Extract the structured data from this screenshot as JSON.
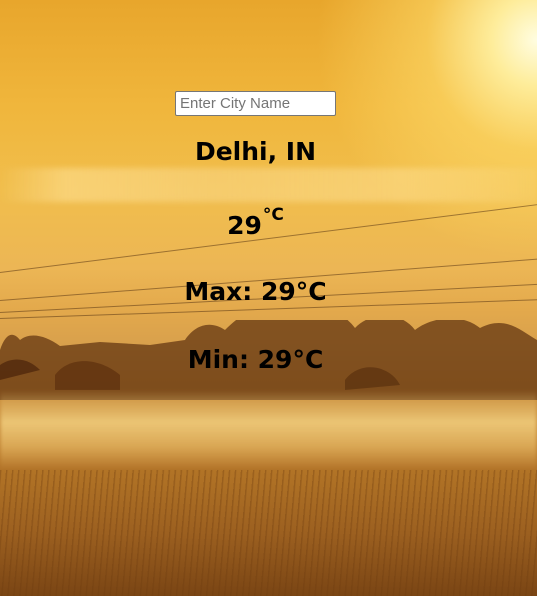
{
  "search": {
    "placeholder": "Enter City Name",
    "value": ""
  },
  "weather": {
    "location": "Delhi, IN",
    "temperature": "29",
    "temperature_unit": "°C",
    "max": "Max: 29°C",
    "min": "Min: 29°C"
  },
  "theme": {
    "text_color": "#000000",
    "background_icon": "sunrise-field-image"
  }
}
